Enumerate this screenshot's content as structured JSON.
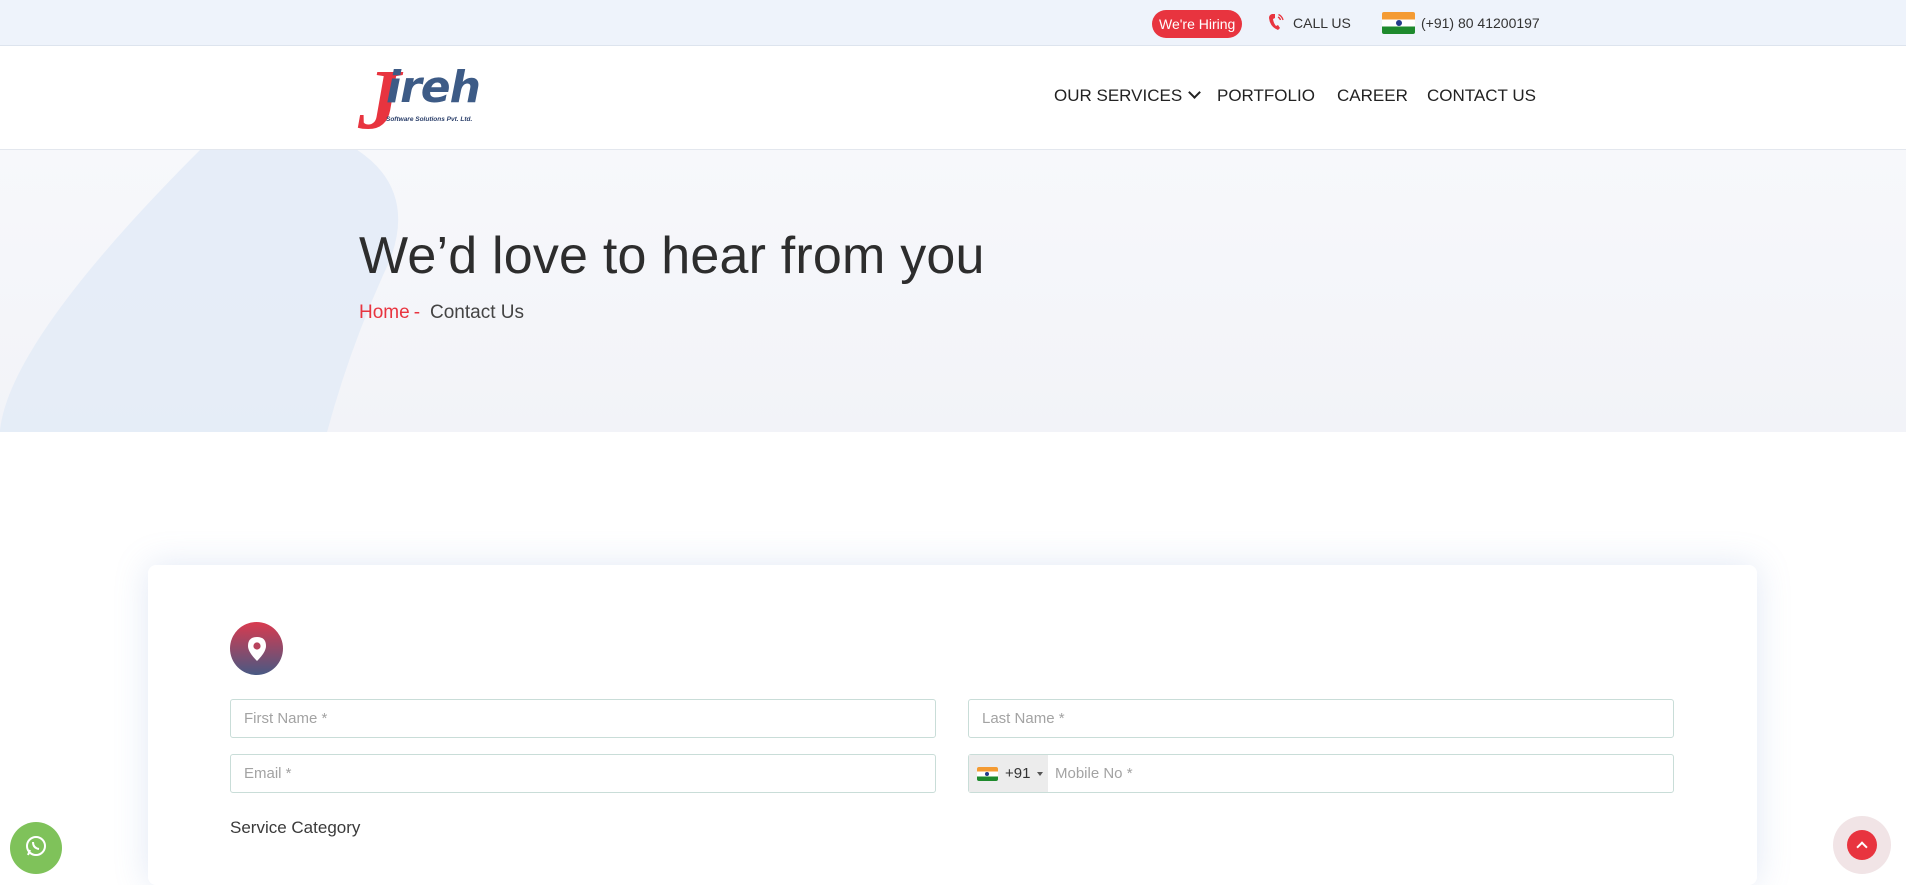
{
  "topbar": {
    "hiring_label": "We're Hiring",
    "call_label": "CALL US",
    "phone_number": "(+91) 80 41200197"
  },
  "header": {
    "logo_letter": "J",
    "logo_rest": "ireh",
    "logo_tagline": "Software Solutions Pvt. Ltd.",
    "nav": {
      "services": "OUR SERVICES",
      "portfolio": "PORTFOLIO",
      "career": "CAREER",
      "contact": "CONTACT US"
    }
  },
  "hero": {
    "title": "We’d love to hear from you",
    "breadcrumb_home": "Home",
    "breadcrumb_sep": "-",
    "breadcrumb_current": "Contact Us"
  },
  "form": {
    "first_name_placeholder": "First Name *",
    "last_name_placeholder": "Last Name *",
    "email_placeholder": "Email *",
    "dial_code": "+91",
    "mobile_placeholder": "Mobile No *",
    "service_category_label": "Service Category"
  },
  "colors": {
    "accent": "#e8343f",
    "brand_blue": "#3d5b86",
    "whatsapp": "#7fc25a"
  },
  "icons": [
    "phone-icon",
    "india-flag-icon",
    "chevron-down-icon",
    "location-pin-icon",
    "whatsapp-icon",
    "arrow-up-icon"
  ]
}
